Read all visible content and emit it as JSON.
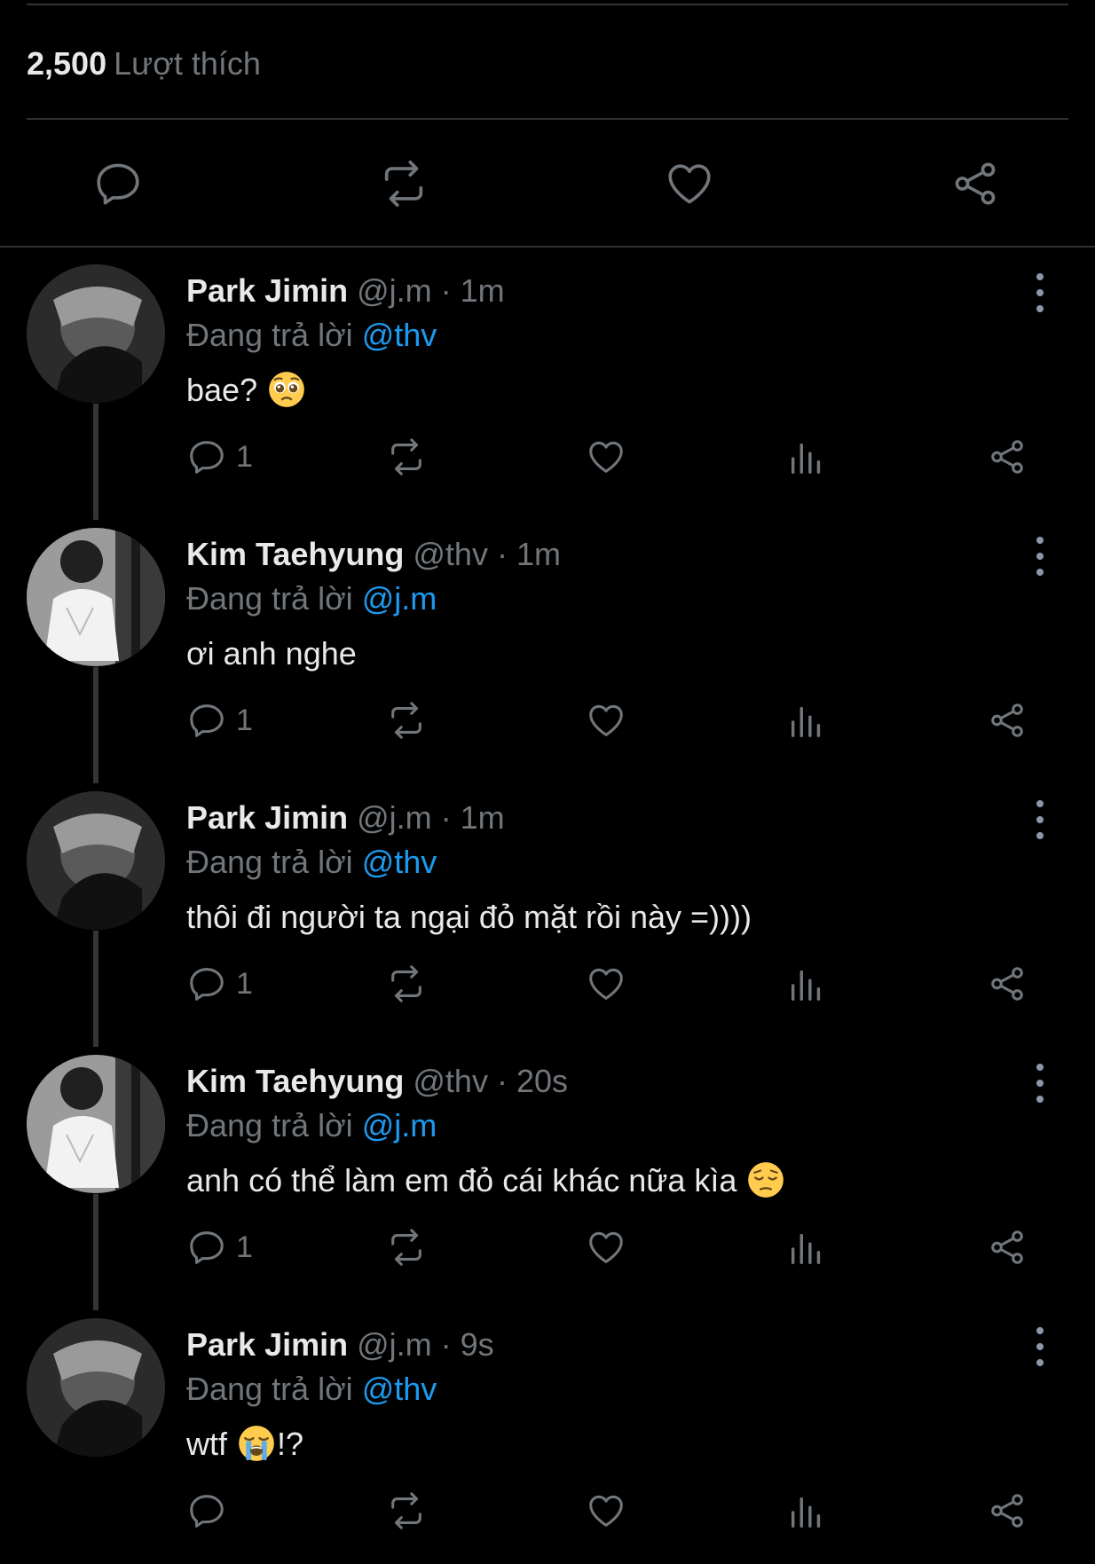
{
  "likes": {
    "count": "2,500",
    "label": "Lượt thích"
  },
  "colors": {
    "background": "#000000",
    "text": "#e7e9ea",
    "muted": "#71767b",
    "accent": "#1d9bf0",
    "divider": "#2f3336"
  },
  "main_actions": [
    "reply-icon",
    "retweet-icon",
    "heart-icon",
    "share-icon"
  ],
  "replies": [
    {
      "name": "Park Jimin",
      "handle": "@j.m",
      "time": "· 1m",
      "replying_prefix": "Đang trả lời",
      "replying_to": "@thv",
      "text": "bae?",
      "emoji": "pleading-face-emoji",
      "reply_count": "1"
    },
    {
      "name": "Kim Taehyung",
      "handle": "@thv",
      "time": "· 1m",
      "replying_prefix": "Đang trả lời",
      "replying_to": "@j.m",
      "text": "ơi anh nghe",
      "emoji": "",
      "reply_count": "1"
    },
    {
      "name": "Park Jimin",
      "handle": "@j.m",
      "time": "· 1m",
      "replying_prefix": "Đang trả lời",
      "replying_to": "@thv",
      "text": "thôi đi người ta ngại đỏ mặt rồi này =))))",
      "emoji": "",
      "reply_count": "1"
    },
    {
      "name": "Kim Taehyung",
      "handle": "@thv",
      "time": "· 20s",
      "replying_prefix": "Đang trả lời",
      "replying_to": "@j.m",
      "text": "anh có thể làm em đỏ cái khác nữa kìa",
      "emoji": "pensive-face-emoji",
      "reply_count": "1"
    },
    {
      "name": "Park Jimin",
      "handle": "@j.m",
      "time": "· 9s",
      "replying_prefix": "Đang trả lời",
      "replying_to": "@thv",
      "text": "wtf",
      "text_after": "!?",
      "emoji": "loudly-crying-face-emoji",
      "reply_count": ""
    }
  ]
}
